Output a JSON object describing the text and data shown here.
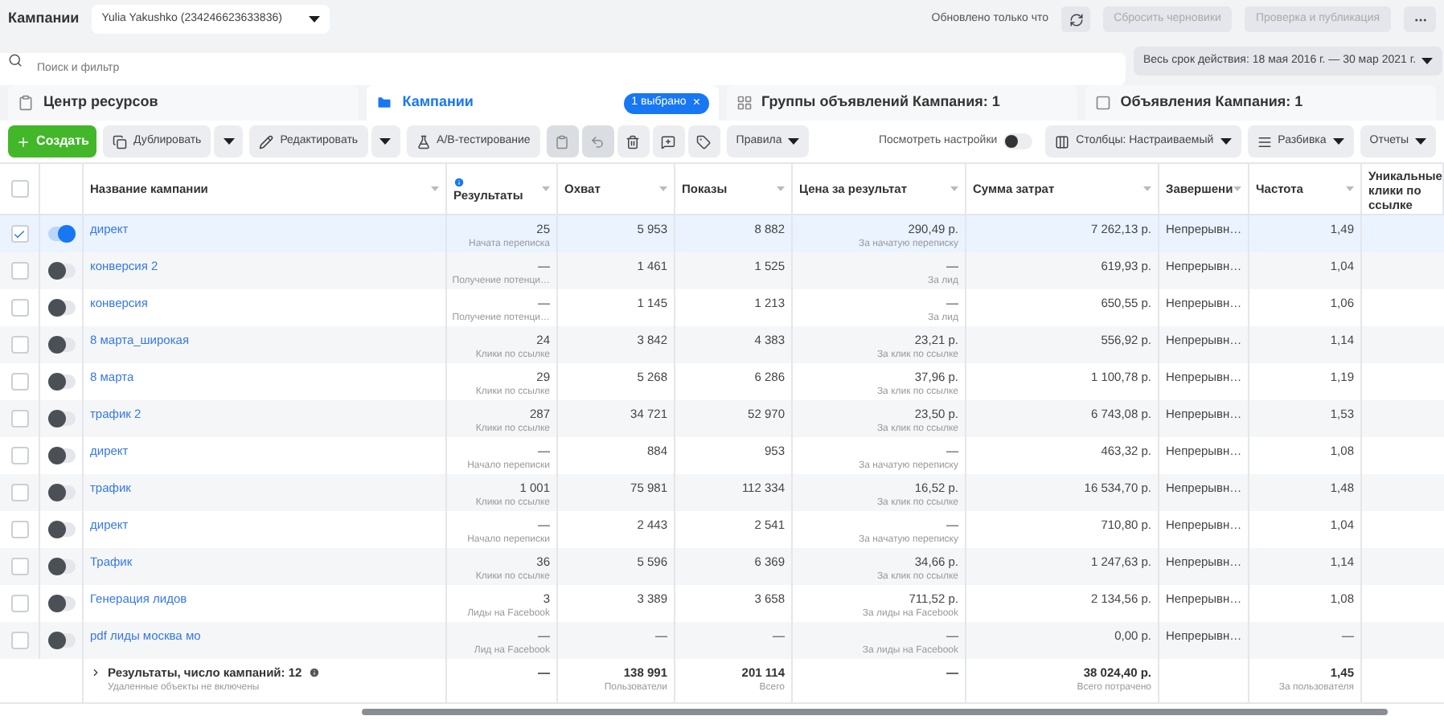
{
  "header": {
    "title": "Кампании",
    "account": "Yulia Yakushko (234246623633836)",
    "updated": "Обновлено только что",
    "discard": {
      "label": "Сбросить черновики",
      "disabled": true
    },
    "publish": {
      "label": "Проверка и публикация",
      "disabled": true
    }
  },
  "search": {
    "placeholder": "Поиск и фильтр"
  },
  "date_range": "Весь срок действия: 18 мая 2016 г. — 30 мар 2021 г.",
  "tabs": [
    {
      "label": "Центр ресурсов",
      "selected": false
    },
    {
      "label": "Кампании",
      "selected": true,
      "badge": "1 выбрано",
      "badge_close": "×"
    },
    {
      "label": "Группы объявлений Кампания: 1",
      "selected": false
    },
    {
      "label": "Объявления Кампания: 1",
      "selected": false
    }
  ],
  "toolbar": {
    "create": "Создать",
    "duplicate": "Дублировать",
    "edit": "Редактировать",
    "ab_test": "A/B-тестирование",
    "rules": "Правила",
    "view_settings": {
      "label": "Посмотреть настройки",
      "on": false
    },
    "columns": "Столбцы: Настраиваемый",
    "breakdown": "Разбивка",
    "reports": "Отчеты"
  },
  "table": {
    "select_all": {
      "checked": false
    },
    "columns": [
      {
        "label": "Название кампании",
        "info": false
      },
      {
        "label": "Результаты",
        "info": true
      },
      {
        "label": "Охват",
        "info": false
      },
      {
        "label": "Показы",
        "info": false
      },
      {
        "label": "Цена за результат",
        "info": false
      },
      {
        "label": "Сумма затрат",
        "info": false
      },
      {
        "label": "Завершени",
        "info": false
      },
      {
        "label": "Частота",
        "info": false
      },
      {
        "label": "Уникальные клики по ссылке",
        "info": false
      }
    ],
    "rows": [
      {
        "selected": true,
        "on": true,
        "name": "директ",
        "results": "25",
        "result_type": "Начата переписка",
        "reach": "5 953",
        "impressions": "8 882",
        "cost_per_result": "290,49 р.",
        "cost_type": "За начатую переписку",
        "spent": "7 262,13 р.",
        "end": "Непрерывн…",
        "frequency": "1,49"
      },
      {
        "selected": false,
        "on": false,
        "name": "конверсия 2",
        "results": "—",
        "result_type": "Получение потенци…",
        "reach": "1 461",
        "impressions": "1 525",
        "cost_per_result": "—",
        "cost_type": "За лид",
        "spent": "619,93 р.",
        "end": "Непрерывн…",
        "frequency": "1,04"
      },
      {
        "selected": false,
        "on": false,
        "name": "конверсия",
        "results": "—",
        "result_type": "Получение потенци…",
        "reach": "1 145",
        "impressions": "1 213",
        "cost_per_result": "—",
        "cost_type": "За лид",
        "spent": "650,55 р.",
        "end": "Непрерывн…",
        "frequency": "1,06"
      },
      {
        "selected": false,
        "on": false,
        "name": "8 марта_широкая",
        "results": "24",
        "result_type": "Клики по ссылке",
        "reach": "3 842",
        "impressions": "4 383",
        "cost_per_result": "23,21 р.",
        "cost_type": "За клик по ссылке",
        "spent": "556,92 р.",
        "end": "Непрерывн…",
        "frequency": "1,14"
      },
      {
        "selected": false,
        "on": false,
        "name": "8 марта",
        "results": "29",
        "result_type": "Клики по ссылке",
        "reach": "5 268",
        "impressions": "6 286",
        "cost_per_result": "37,96 р.",
        "cost_type": "За клик по ссылке",
        "spent": "1 100,78 р.",
        "end": "Непрерывн…",
        "frequency": "1,19"
      },
      {
        "selected": false,
        "on": false,
        "name": "трафик 2",
        "results": "287",
        "result_type": "Клики по ссылке",
        "reach": "34 721",
        "impressions": "52 970",
        "cost_per_result": "23,50 р.",
        "cost_type": "За клик по ссылке",
        "spent": "6 743,08 р.",
        "end": "Непрерывн…",
        "frequency": "1,53"
      },
      {
        "selected": false,
        "on": false,
        "name": "директ",
        "results": "—",
        "result_type": "Начало переписки",
        "reach": "884",
        "impressions": "953",
        "cost_per_result": "—",
        "cost_type": "За начатую переписку",
        "spent": "463,32 р.",
        "end": "Непрерывн…",
        "frequency": "1,08"
      },
      {
        "selected": false,
        "on": false,
        "name": "трафик",
        "results": "1 001",
        "result_type": "Клики по ссылке",
        "reach": "75 981",
        "impressions": "112 334",
        "cost_per_result": "16,52 р.",
        "cost_type": "За клик по ссылке",
        "spent": "16 534,70 р.",
        "end": "Непрерывн…",
        "frequency": "1,48"
      },
      {
        "selected": false,
        "on": false,
        "name": "директ",
        "results": "—",
        "result_type": "Начало переписки",
        "reach": "2 443",
        "impressions": "2 541",
        "cost_per_result": "—",
        "cost_type": "За начатую переписку",
        "spent": "710,80 р.",
        "end": "Непрерывн…",
        "frequency": "1,04"
      },
      {
        "selected": false,
        "on": false,
        "name": "Трафик",
        "results": "36",
        "result_type": "Клики по ссылке",
        "reach": "5 596",
        "impressions": "6 369",
        "cost_per_result": "34,66 р.",
        "cost_type": "За клик по ссылке",
        "spent": "1 247,63 р.",
        "end": "Непрерывн…",
        "frequency": "1,14"
      },
      {
        "selected": false,
        "on": false,
        "name": "Генерация лидов",
        "results": "3",
        "result_type": "Лиды на Facebook",
        "reach": "3 389",
        "impressions": "3 658",
        "cost_per_result": "711,52 р.",
        "cost_type": "За лиды на Facebook",
        "spent": "2 134,56 р.",
        "end": "Непрерывн…",
        "frequency": "1,08"
      },
      {
        "selected": false,
        "on": false,
        "name": "pdf лиды москва мо",
        "results": "—",
        "result_type": "Лид на Facebook",
        "reach": "—",
        "impressions": "—",
        "cost_per_result": "—",
        "cost_type": "За лиды на Facebook",
        "spent": "0,00 р.",
        "end": "Непрерывн…",
        "frequency": "—"
      }
    ],
    "totals": {
      "label": "Результаты, число кампаний: 12",
      "note": "Удаленные объекты не включены",
      "results": "—",
      "reach": "138 991",
      "reach_note": "Пользователи",
      "impressions": "201 114",
      "impressions_note": "Всего",
      "cost_per_result": "—",
      "spent": "38 024,40 р.",
      "spent_note": "Всего потрачено",
      "frequency": "1,45",
      "frequency_note": "За пользователя"
    }
  }
}
